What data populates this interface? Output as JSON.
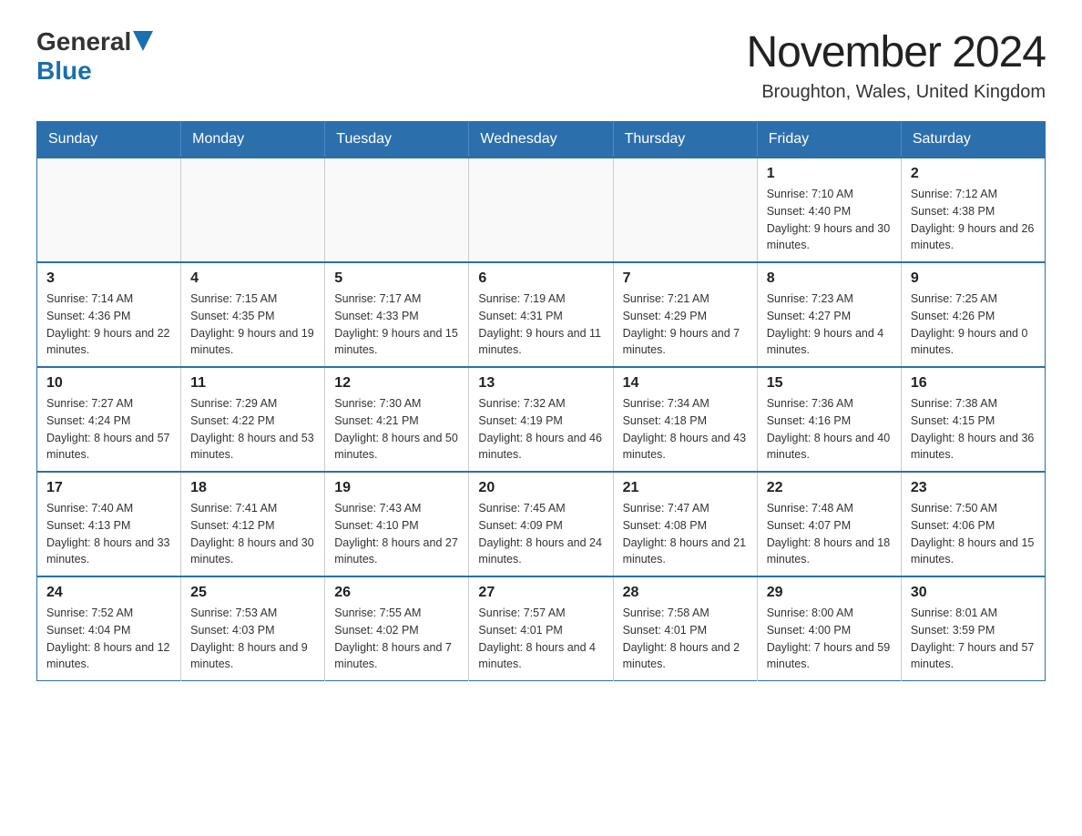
{
  "logo": {
    "general": "General",
    "blue": "Blue"
  },
  "title": "November 2024",
  "subtitle": "Broughton, Wales, United Kingdom",
  "days_of_week": [
    "Sunday",
    "Monday",
    "Tuesday",
    "Wednesday",
    "Thursday",
    "Friday",
    "Saturday"
  ],
  "weeks": [
    [
      {
        "day": "",
        "sunrise": "",
        "sunset": "",
        "daylight": ""
      },
      {
        "day": "",
        "sunrise": "",
        "sunset": "",
        "daylight": ""
      },
      {
        "day": "",
        "sunrise": "",
        "sunset": "",
        "daylight": ""
      },
      {
        "day": "",
        "sunrise": "",
        "sunset": "",
        "daylight": ""
      },
      {
        "day": "",
        "sunrise": "",
        "sunset": "",
        "daylight": ""
      },
      {
        "day": "1",
        "sunrise": "Sunrise: 7:10 AM",
        "sunset": "Sunset: 4:40 PM",
        "daylight": "Daylight: 9 hours and 30 minutes."
      },
      {
        "day": "2",
        "sunrise": "Sunrise: 7:12 AM",
        "sunset": "Sunset: 4:38 PM",
        "daylight": "Daylight: 9 hours and 26 minutes."
      }
    ],
    [
      {
        "day": "3",
        "sunrise": "Sunrise: 7:14 AM",
        "sunset": "Sunset: 4:36 PM",
        "daylight": "Daylight: 9 hours and 22 minutes."
      },
      {
        "day": "4",
        "sunrise": "Sunrise: 7:15 AM",
        "sunset": "Sunset: 4:35 PM",
        "daylight": "Daylight: 9 hours and 19 minutes."
      },
      {
        "day": "5",
        "sunrise": "Sunrise: 7:17 AM",
        "sunset": "Sunset: 4:33 PM",
        "daylight": "Daylight: 9 hours and 15 minutes."
      },
      {
        "day": "6",
        "sunrise": "Sunrise: 7:19 AM",
        "sunset": "Sunset: 4:31 PM",
        "daylight": "Daylight: 9 hours and 11 minutes."
      },
      {
        "day": "7",
        "sunrise": "Sunrise: 7:21 AM",
        "sunset": "Sunset: 4:29 PM",
        "daylight": "Daylight: 9 hours and 7 minutes."
      },
      {
        "day": "8",
        "sunrise": "Sunrise: 7:23 AM",
        "sunset": "Sunset: 4:27 PM",
        "daylight": "Daylight: 9 hours and 4 minutes."
      },
      {
        "day": "9",
        "sunrise": "Sunrise: 7:25 AM",
        "sunset": "Sunset: 4:26 PM",
        "daylight": "Daylight: 9 hours and 0 minutes."
      }
    ],
    [
      {
        "day": "10",
        "sunrise": "Sunrise: 7:27 AM",
        "sunset": "Sunset: 4:24 PM",
        "daylight": "Daylight: 8 hours and 57 minutes."
      },
      {
        "day": "11",
        "sunrise": "Sunrise: 7:29 AM",
        "sunset": "Sunset: 4:22 PM",
        "daylight": "Daylight: 8 hours and 53 minutes."
      },
      {
        "day": "12",
        "sunrise": "Sunrise: 7:30 AM",
        "sunset": "Sunset: 4:21 PM",
        "daylight": "Daylight: 8 hours and 50 minutes."
      },
      {
        "day": "13",
        "sunrise": "Sunrise: 7:32 AM",
        "sunset": "Sunset: 4:19 PM",
        "daylight": "Daylight: 8 hours and 46 minutes."
      },
      {
        "day": "14",
        "sunrise": "Sunrise: 7:34 AM",
        "sunset": "Sunset: 4:18 PM",
        "daylight": "Daylight: 8 hours and 43 minutes."
      },
      {
        "day": "15",
        "sunrise": "Sunrise: 7:36 AM",
        "sunset": "Sunset: 4:16 PM",
        "daylight": "Daylight: 8 hours and 40 minutes."
      },
      {
        "day": "16",
        "sunrise": "Sunrise: 7:38 AM",
        "sunset": "Sunset: 4:15 PM",
        "daylight": "Daylight: 8 hours and 36 minutes."
      }
    ],
    [
      {
        "day": "17",
        "sunrise": "Sunrise: 7:40 AM",
        "sunset": "Sunset: 4:13 PM",
        "daylight": "Daylight: 8 hours and 33 minutes."
      },
      {
        "day": "18",
        "sunrise": "Sunrise: 7:41 AM",
        "sunset": "Sunset: 4:12 PM",
        "daylight": "Daylight: 8 hours and 30 minutes."
      },
      {
        "day": "19",
        "sunrise": "Sunrise: 7:43 AM",
        "sunset": "Sunset: 4:10 PM",
        "daylight": "Daylight: 8 hours and 27 minutes."
      },
      {
        "day": "20",
        "sunrise": "Sunrise: 7:45 AM",
        "sunset": "Sunset: 4:09 PM",
        "daylight": "Daylight: 8 hours and 24 minutes."
      },
      {
        "day": "21",
        "sunrise": "Sunrise: 7:47 AM",
        "sunset": "Sunset: 4:08 PM",
        "daylight": "Daylight: 8 hours and 21 minutes."
      },
      {
        "day": "22",
        "sunrise": "Sunrise: 7:48 AM",
        "sunset": "Sunset: 4:07 PM",
        "daylight": "Daylight: 8 hours and 18 minutes."
      },
      {
        "day": "23",
        "sunrise": "Sunrise: 7:50 AM",
        "sunset": "Sunset: 4:06 PM",
        "daylight": "Daylight: 8 hours and 15 minutes."
      }
    ],
    [
      {
        "day": "24",
        "sunrise": "Sunrise: 7:52 AM",
        "sunset": "Sunset: 4:04 PM",
        "daylight": "Daylight: 8 hours and 12 minutes."
      },
      {
        "day": "25",
        "sunrise": "Sunrise: 7:53 AM",
        "sunset": "Sunset: 4:03 PM",
        "daylight": "Daylight: 8 hours and 9 minutes."
      },
      {
        "day": "26",
        "sunrise": "Sunrise: 7:55 AM",
        "sunset": "Sunset: 4:02 PM",
        "daylight": "Daylight: 8 hours and 7 minutes."
      },
      {
        "day": "27",
        "sunrise": "Sunrise: 7:57 AM",
        "sunset": "Sunset: 4:01 PM",
        "daylight": "Daylight: 8 hours and 4 minutes."
      },
      {
        "day": "28",
        "sunrise": "Sunrise: 7:58 AM",
        "sunset": "Sunset: 4:01 PM",
        "daylight": "Daylight: 8 hours and 2 minutes."
      },
      {
        "day": "29",
        "sunrise": "Sunrise: 8:00 AM",
        "sunset": "Sunset: 4:00 PM",
        "daylight": "Daylight: 7 hours and 59 minutes."
      },
      {
        "day": "30",
        "sunrise": "Sunrise: 8:01 AM",
        "sunset": "Sunset: 3:59 PM",
        "daylight": "Daylight: 7 hours and 57 minutes."
      }
    ]
  ]
}
